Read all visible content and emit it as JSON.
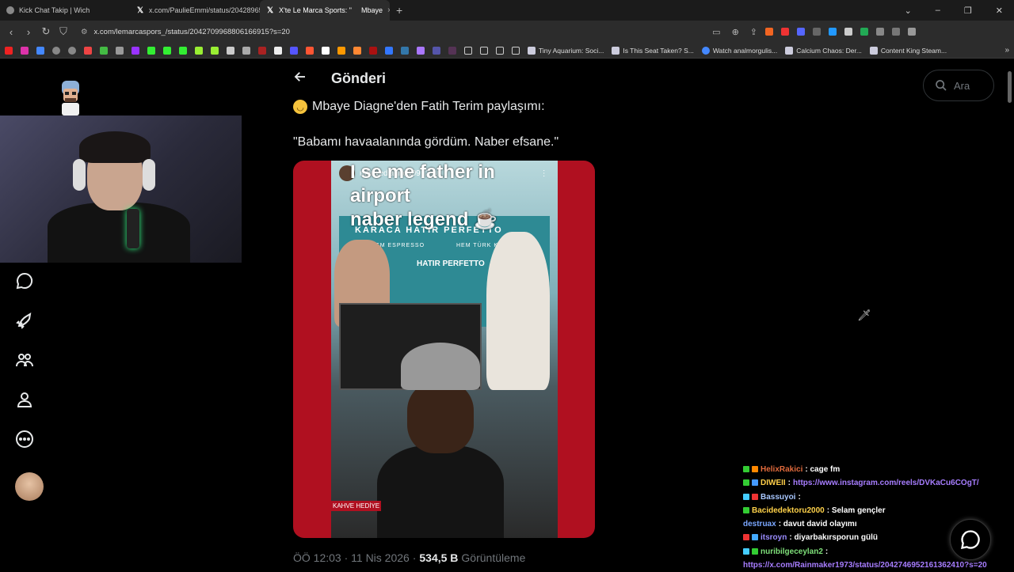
{
  "tabs": [
    {
      "title": "Kick Chat Takip | Wich",
      "icon": "globe-icon",
      "active": false
    },
    {
      "title": "x.com/PaulieEmmi/status/20428965",
      "icon": "x-logo-icon",
      "active": false
    },
    {
      "title": "X'te Le Marca Sports: \"",
      "title_tail": "Mbaye",
      "icon": "x-logo-icon",
      "active": true
    }
  ],
  "tab_close_glyph": "×",
  "new_tab_glyph": "+",
  "window_controls": [
    "⌄",
    "–",
    "❐",
    "✕"
  ],
  "address": {
    "url": "x.com/lemarcaspors_/status/2042709968806166915?s=20"
  },
  "bookmarks": [
    {
      "label": "Tiny Aquarium: Soci..."
    },
    {
      "label": "Is This Seat Taken? S..."
    },
    {
      "label": "Watch analmorgulis..."
    },
    {
      "label": "Calcium Chaos: Der..."
    },
    {
      "label": "Content King Steam..."
    }
  ],
  "post": {
    "header_title": "Gönderi",
    "line1": "Mbaye Diagne'den Fatih Terim paylaşımı:",
    "line2": "\"Babamı havaalanında gördüm. Naber efsane.\"",
    "story_user": "mbayediagne909",
    "story_time": "2 sa",
    "story_caption_1": "I se me father in airport",
    "story_caption_2": "naber legend ☕",
    "banner_title": "KARACA HATIR PERFETTO",
    "banner_sub1": "HEM ESPRESSO",
    "banner_sub2": "HEM TÜRK KAHVESİ",
    "banner_logo": "HATIR PERFETTO",
    "sign_text": "KAHVE HEDİYE",
    "time": "ÖÖ 12:03 · 11 Nis 2026 ·",
    "views_count": "534,5 B",
    "views_label": "Görüntüleme"
  },
  "search": {
    "placeholder": "Ara"
  },
  "chat": [
    {
      "user": "HelixRakici",
      "msg": ": cage fm",
      "color": "#e06a3c",
      "badges": [
        "#3c3",
        "#f80"
      ]
    },
    {
      "user": "DIWEII",
      "msg": ":",
      "link": "https://www.instagram.com/reels/DVKaCu6COgT/",
      "color": "#ffcf4a",
      "badges": [
        "#3c3",
        "#49f"
      ]
    },
    {
      "user": "Bassuyoi",
      "msg": ":",
      "color": "#a8c7ff",
      "badges": [
        "#4cf",
        "#e33"
      ]
    },
    {
      "user": "Bacidedektoru2000",
      "msg": ": Selam gençler",
      "color": "#ffd24a",
      "badges": [
        "#3c3"
      ]
    },
    {
      "user": "destruax",
      "msg": ": davut david olayımı",
      "color": "#7aa7ff",
      "badges": []
    },
    {
      "user": "itsroyn",
      "msg": ": diyarbakırsporun gülü",
      "color": "#9a8cff",
      "badges": [
        "#e33",
        "#4af"
      ]
    },
    {
      "user": "nuribilgeceylan2",
      "msg": ":",
      "color": "#7fe07a",
      "badges": [
        "#4cf",
        "#3c3"
      ]
    },
    {
      "user": "",
      "msg": "",
      "link": "https://x.com/Rainmaker1973/status/2042746952161362410?s=20",
      "color": "#a77dff",
      "badges": []
    }
  ]
}
